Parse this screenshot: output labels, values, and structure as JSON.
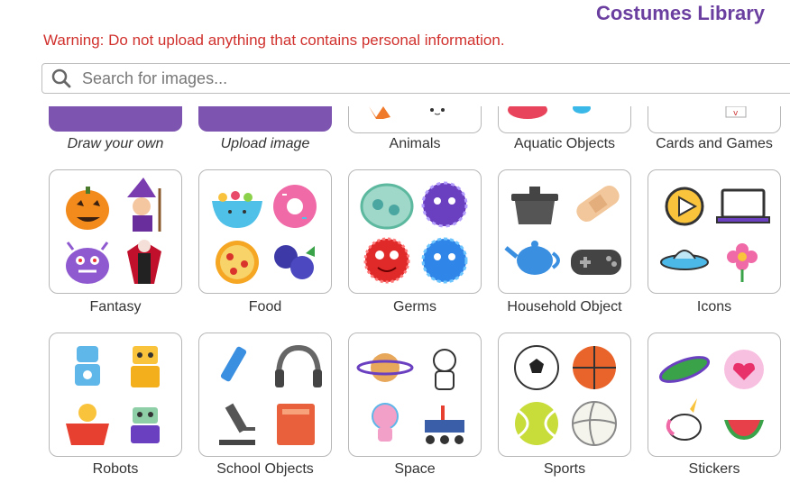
{
  "header": {
    "title": "Costumes Library"
  },
  "warning": "Warning: Do not upload anything that contains personal information.",
  "search": {
    "placeholder": "Search for images..."
  },
  "top_row": [
    {
      "label": "Draw your own"
    },
    {
      "label": "Upload image"
    },
    {
      "label": "Animals"
    },
    {
      "label": "Aquatic Objects"
    },
    {
      "label": "Cards and Games"
    }
  ],
  "row1": [
    {
      "label": "Fantasy",
      "icons": [
        "pumpkin-icon",
        "witch-icon",
        "purple-monster-icon",
        "vampire-icon"
      ]
    },
    {
      "label": "Food",
      "icons": [
        "cereal-bowl-icon",
        "donut-icon",
        "pizza-icon",
        "blueberries-icon"
      ]
    },
    {
      "label": "Germs",
      "icons": [
        "green-germ-icon",
        "purple-germ-icon",
        "red-germ-icon",
        "blue-germ-icon"
      ]
    },
    {
      "label": "Household Object",
      "icons": [
        "pot-icon",
        "bandage-icon",
        "teapot-icon",
        "game-controller-icon"
      ]
    },
    {
      "label": "Icons",
      "icons": [
        "play-button-icon",
        "laptop-icon",
        "ufo-icon",
        "flower-icon"
      ]
    }
  ],
  "row2": [
    {
      "label": "Robots",
      "icons": [
        "blue-robot-icon",
        "yellow-robot-icon",
        "red-robot-icon",
        "green-robot-icon"
      ]
    },
    {
      "label": "School Objects",
      "icons": [
        "pen-icon",
        "headphones-icon",
        "microscope-icon",
        "book-icon"
      ]
    },
    {
      "label": "Space",
      "icons": [
        "saturn-icon",
        "astronaut-icon",
        "pink-alien-icon",
        "mars-rover-icon"
      ]
    },
    {
      "label": "Sports",
      "icons": [
        "soccer-ball-icon",
        "basketball-icon",
        "tennis-ball-icon",
        "volleyball-icon"
      ]
    },
    {
      "label": "Stickers",
      "icons": [
        "spaceship-sticker-icon",
        "heart-sticker-icon",
        "unicorn-sticker-icon",
        "watermelon-sticker-icon"
      ]
    }
  ],
  "colors": {
    "accent": "#6b3fa0",
    "warning": "#d0312d",
    "card_fill": "#7d55b0"
  }
}
